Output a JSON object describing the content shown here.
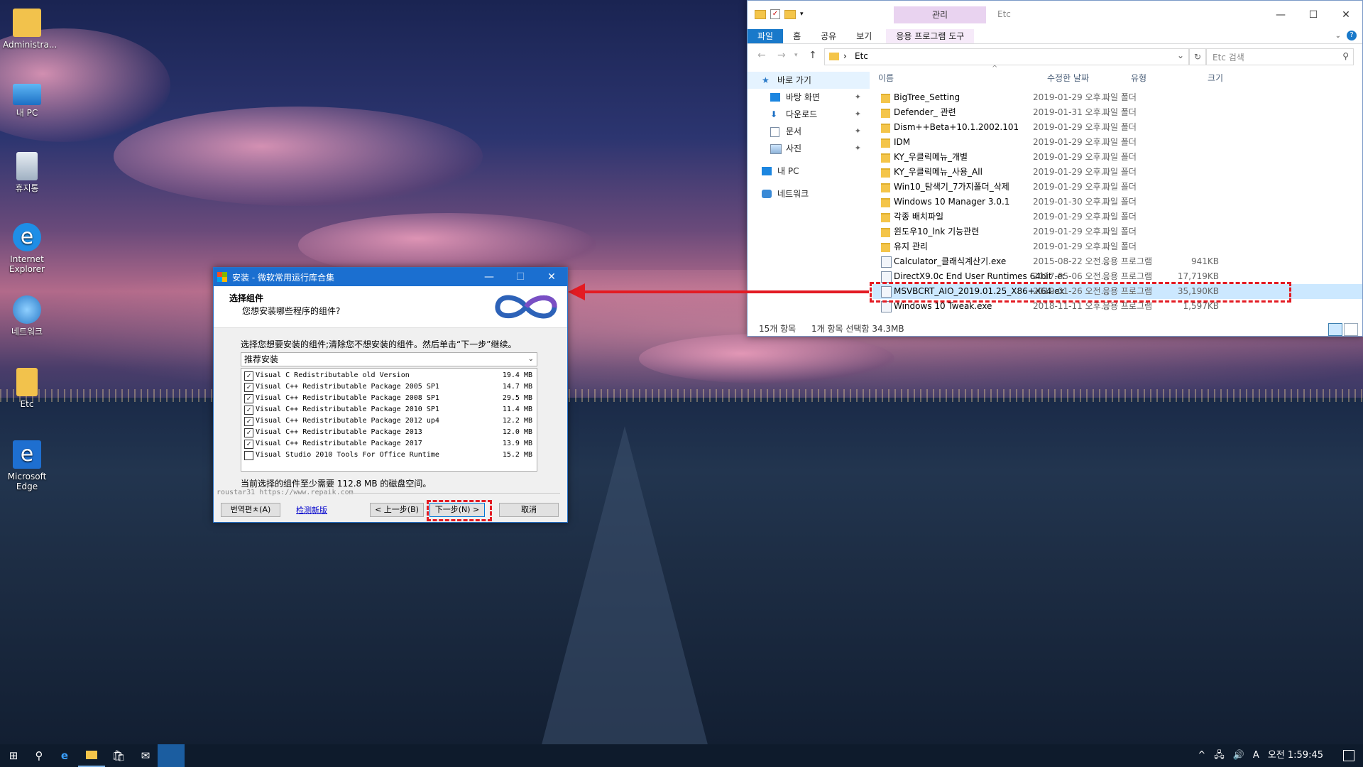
{
  "desktop": {
    "icons": [
      {
        "label": "Administra..."
      },
      {
        "label": "내 PC"
      },
      {
        "label": "휴지통"
      },
      {
        "label": "Internet Explorer"
      },
      {
        "label": "네트워크"
      },
      {
        "label": "Etc"
      },
      {
        "label": "Microsoft Edge"
      }
    ]
  },
  "explorer": {
    "ribbon_context_header": "관리",
    "window_title": "Etc",
    "tabs": [
      "파일",
      "홈",
      "공유",
      "보기",
      "응용 프로그램 도구"
    ],
    "controls": {
      "minimize": "—",
      "maximize": "☐",
      "close": "✕"
    },
    "path_sep": "›",
    "address": "Etc",
    "search_placeholder": "Etc 검색",
    "nav": [
      {
        "label": "바로 가기"
      },
      {
        "label": "바탕 화면"
      },
      {
        "label": "다운로드"
      },
      {
        "label": "문서"
      },
      {
        "label": "사진"
      },
      {
        "label": "내 PC"
      },
      {
        "label": "네트워크"
      }
    ],
    "columns": [
      "이름",
      "수정한 날짜",
      "유형",
      "크기"
    ],
    "files": [
      {
        "name": "BigTree_Setting",
        "date": "2019-01-29 오후...",
        "type": "파일 폴더",
        "size": ""
      },
      {
        "name": "Defender_ 관련",
        "date": "2019-01-31 오후...",
        "type": "파일 폴더",
        "size": ""
      },
      {
        "name": "Dism++Beta+10.1.2002.101",
        "date": "2019-01-29 오후...",
        "type": "파일 폴더",
        "size": ""
      },
      {
        "name": "IDM",
        "date": "2019-01-29 오후...",
        "type": "파일 폴더",
        "size": ""
      },
      {
        "name": "KY_우클릭메뉴_개별",
        "date": "2019-01-29 오후...",
        "type": "파일 폴더",
        "size": ""
      },
      {
        "name": "KY_우클릭메뉴_사용_All",
        "date": "2019-01-29 오후...",
        "type": "파일 폴더",
        "size": ""
      },
      {
        "name": "Win10_탐색기_7가지폴더_삭제",
        "date": "2019-01-29 오후...",
        "type": "파일 폴더",
        "size": ""
      },
      {
        "name": "Windows 10 Manager 3.0.1",
        "date": "2019-01-30 오후...",
        "type": "파일 폴더",
        "size": ""
      },
      {
        "name": "각종 배치파일",
        "date": "2019-01-29 오후...",
        "type": "파일 폴더",
        "size": ""
      },
      {
        "name": "윈도우10_lnk 기능관련",
        "date": "2019-01-29 오후...",
        "type": "파일 폴더",
        "size": ""
      },
      {
        "name": "유지 관리",
        "date": "2019-01-29 오후...",
        "type": "파일 폴더",
        "size": ""
      },
      {
        "name": "Calculator_클래식계산기.exe",
        "date": "2015-08-22 오전...",
        "type": "응용 프로그램",
        "size": "941KB"
      },
      {
        "name": "DirectX9.0c End User Runtimes 64bit .exe",
        "date": "2017-05-06 오전...",
        "type": "응용 프로그램",
        "size": "17,719KB"
      },
      {
        "name": "MSVBCRT_AIO_2019.01.25_X86+X64.exe",
        "date": "2019-01-26 오전...",
        "type": "응용 프로그램",
        "size": "35,190KB"
      },
      {
        "name": "Windows 10 Tweak.exe",
        "date": "2018-11-11 오후...",
        "type": "응용 프로그램",
        "size": "1,597KB"
      }
    ],
    "status_count": "15개 항목",
    "status_selected": "1개 항목 선택함 34.3MB"
  },
  "installer": {
    "title": "安装 - 微软常用运行库合集",
    "controls": {
      "minimize": "—",
      "maximize": "☐",
      "close": "✕"
    },
    "header_title": "选择组件",
    "header_subtitle": "您想安装哪些程序的组件?",
    "instruction": "选择您想要安装的组件;清除您不想安装的组件。然后单击“下一步”继续。",
    "preset": "推荐安装",
    "components": [
      {
        "name": "Visual C Redistributable old Version",
        "size": "19.4 MB",
        "checked": true
      },
      {
        "name": "Visual C++ Redistributable Package 2005 SP1",
        "size": "14.7 MB",
        "checked": true
      },
      {
        "name": "Visual C++ Redistributable Package 2008 SP1",
        "size": "29.5 MB",
        "checked": true
      },
      {
        "name": "Visual C++ Redistributable Package 2010 SP1",
        "size": "11.4 MB",
        "checked": true
      },
      {
        "name": "Visual C++ Redistributable Package 2012 up4",
        "size": "12.2 MB",
        "checked": true
      },
      {
        "name": "Visual C++ Redistributable Package 2013",
        "size": "12.0 MB",
        "checked": true
      },
      {
        "name": "Visual C++ Redistributable Package 2017",
        "size": "13.9 MB",
        "checked": true
      },
      {
        "name": "Visual Studio 2010 Tools For Office Runtime",
        "size": "15.2 MB",
        "checked": false
      }
    ],
    "check_mark": "✓",
    "required_space": "当前选择的组件至少需要 112.8 MB 的磁盘空间。",
    "footer_credit": "roustar31   https://www.repaik.com",
    "buttons": {
      "left": "번역편ㅊ(A)",
      "link": "检测新版",
      "back": "< 上一步(B)",
      "next": "下一步(N) >",
      "cancel": "取消"
    }
  },
  "taskbar": {
    "clock": "오전 1:59:45",
    "ime": "A"
  },
  "colors": {
    "accent": "#1979ca",
    "highlight_red": "#e31b23",
    "selected_row": "#cce8ff"
  }
}
